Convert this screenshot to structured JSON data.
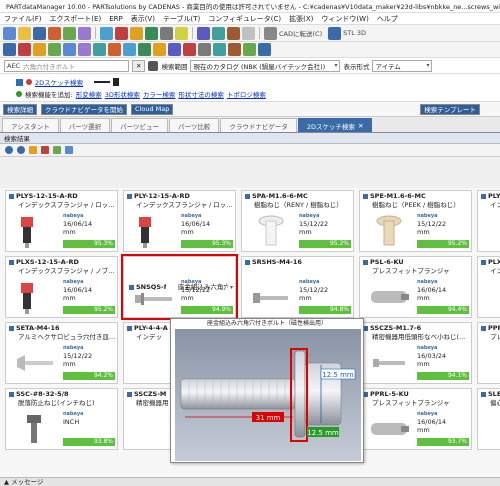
{
  "window": {
    "title": "PARTdataManager 10.00 - PARTsolutions by CADENAS - 商業目的の使用は許可されていません - C:¥cadenas¥V10data_maker¥23d-libs¥nbkke_ne...screws_with_v_h"
  },
  "menu": [
    "ファイル(F)",
    "エクスポート(E)",
    "ERP",
    "表示(V)",
    "テーブル(T)",
    "コンフィギュレータ(C)",
    "拡張(X)",
    "ウィンドウ(W)",
    "ヘルプ"
  ],
  "toolbar": {
    "cad_label": "CADに転送(C)",
    "stl_label": "STL 3D"
  },
  "search": {
    "prefix": "AEC",
    "placeholder": "六角穴付きボルト",
    "range_label": "検索範囲",
    "range_value": "現在のカタログ (NBK (鍋屋バイテック会社))",
    "mode_label": "表示形式",
    "mode_value": "アイテム"
  },
  "sketch": {
    "title": "2Dスケッチ検索"
  },
  "search_functions": {
    "label": "検索機能を追加:",
    "items": [
      "形変検索",
      "3D形状検索",
      "カラー検索",
      "形状寸法の検索",
      "トポロジ検索"
    ]
  },
  "actions": {
    "details": "検索詳細",
    "cloud_nav": "クラウドナビゲータを開始",
    "cloud_map": "Cloud Map",
    "template": "検索テンプレート"
  },
  "tabs": [
    "アシスタント",
    "パーツ選択",
    "パーツビュー",
    "パーツ比較",
    "クラウドナビゲータ",
    "2Dスケッチ検索"
  ],
  "results_label": "検索結果",
  "cards": [
    {
      "id": "PLYS-12-15-A-RD",
      "desc": "インデックスプランジャ / ロッ...",
      "date": "16/06/14",
      "unit": "mm",
      "score": "95.3%"
    },
    {
      "id": "PLY-12-15-A-RD",
      "desc": "インデックスプランジャ / ロッ...",
      "date": "16/06/14",
      "unit": "mm",
      "score": "95.3%"
    },
    {
      "id": "SPA-M1.6-6-MC",
      "desc": "樹脂ねじ（RENY / 樹脂ねじ）",
      "date": "15/12/22",
      "unit": "mm",
      "score": "95.2%"
    },
    {
      "id": "SPE-M1.6-6-MC",
      "desc": "樹脂ねじ（PEEK / 樹脂ねじ）",
      "date": "15/12/22",
      "unit": "mm",
      "score": "95.2%"
    },
    {
      "id": "PLYS",
      "desc": "インデ",
      "date": "",
      "unit": "",
      "score": ""
    },
    {
      "id": "PLXS-12-15-A-RD",
      "desc": "インデックスプランジャ / ノブ...",
      "date": "16/06/14",
      "unit": "mm",
      "score": "95.2%"
    },
    {
      "id": "SNSQS-M6-25-PM",
      "desc": "座金組込み六角穴付きボルト（...",
      "date": "15/12/22",
      "unit": "mm",
      "score": "94.9%"
    },
    {
      "id": "SRSHS-M4-16",
      "desc": "",
      "date": "15/12/22",
      "unit": "mm",
      "score": "94.8%"
    },
    {
      "id": "PSL-6-KU",
      "desc": "プレスフィットプランジャ",
      "date": "16/06/14",
      "unit": "mm",
      "score": "94.4%"
    },
    {
      "id": "PLX-",
      "desc": "インデ",
      "date": "",
      "unit": "",
      "score": ""
    },
    {
      "id": "SETA-M4-16",
      "desc": "アルミヘクサロビュラ穴付き皿...",
      "date": "15/12/22",
      "unit": "mm",
      "score": "94.2%"
    },
    {
      "id": "PLY-4-4-A",
      "desc": "インデッ",
      "date": "",
      "unit": "",
      "score": ""
    },
    {
      "id": "SSCZS-M1.7-6",
      "desc": "精密機器用低頭形なべ小ねじ(...",
      "date": "16/03/24",
      "unit": "mm",
      "score": "94.1%"
    },
    {
      "id": "PPRL",
      "desc": "プレ",
      "date": "",
      "unit": "",
      "score": ""
    },
    {
      "id": "SSC-#8-32-5/8",
      "desc": "脱落防止ねじ(インチねじ)",
      "date": "",
      "unit": "INCH",
      "score": "93.8%"
    },
    {
      "id": "SSCZS-M",
      "desc": "精密機器用",
      "date": "",
      "unit": "",
      "score": ""
    },
    {
      "id": "PPRL-5-KU",
      "desc": "プレスフィットプランジャ",
      "date": "16/06/14",
      "unit": "mm",
      "score": "93.7%"
    },
    {
      "id": "SLEC",
      "desc": "偏心",
      "date": "",
      "unit": "",
      "score": ""
    }
  ],
  "popup": {
    "title": "座金組込み六角穴付きボルト（磁性検出用）",
    "dim_length": "31 mm",
    "dim_dia": "12.5 mm",
    "dim_dia2": "12.5 mm"
  },
  "status": "メッセージ",
  "vendor": "nabeya"
}
